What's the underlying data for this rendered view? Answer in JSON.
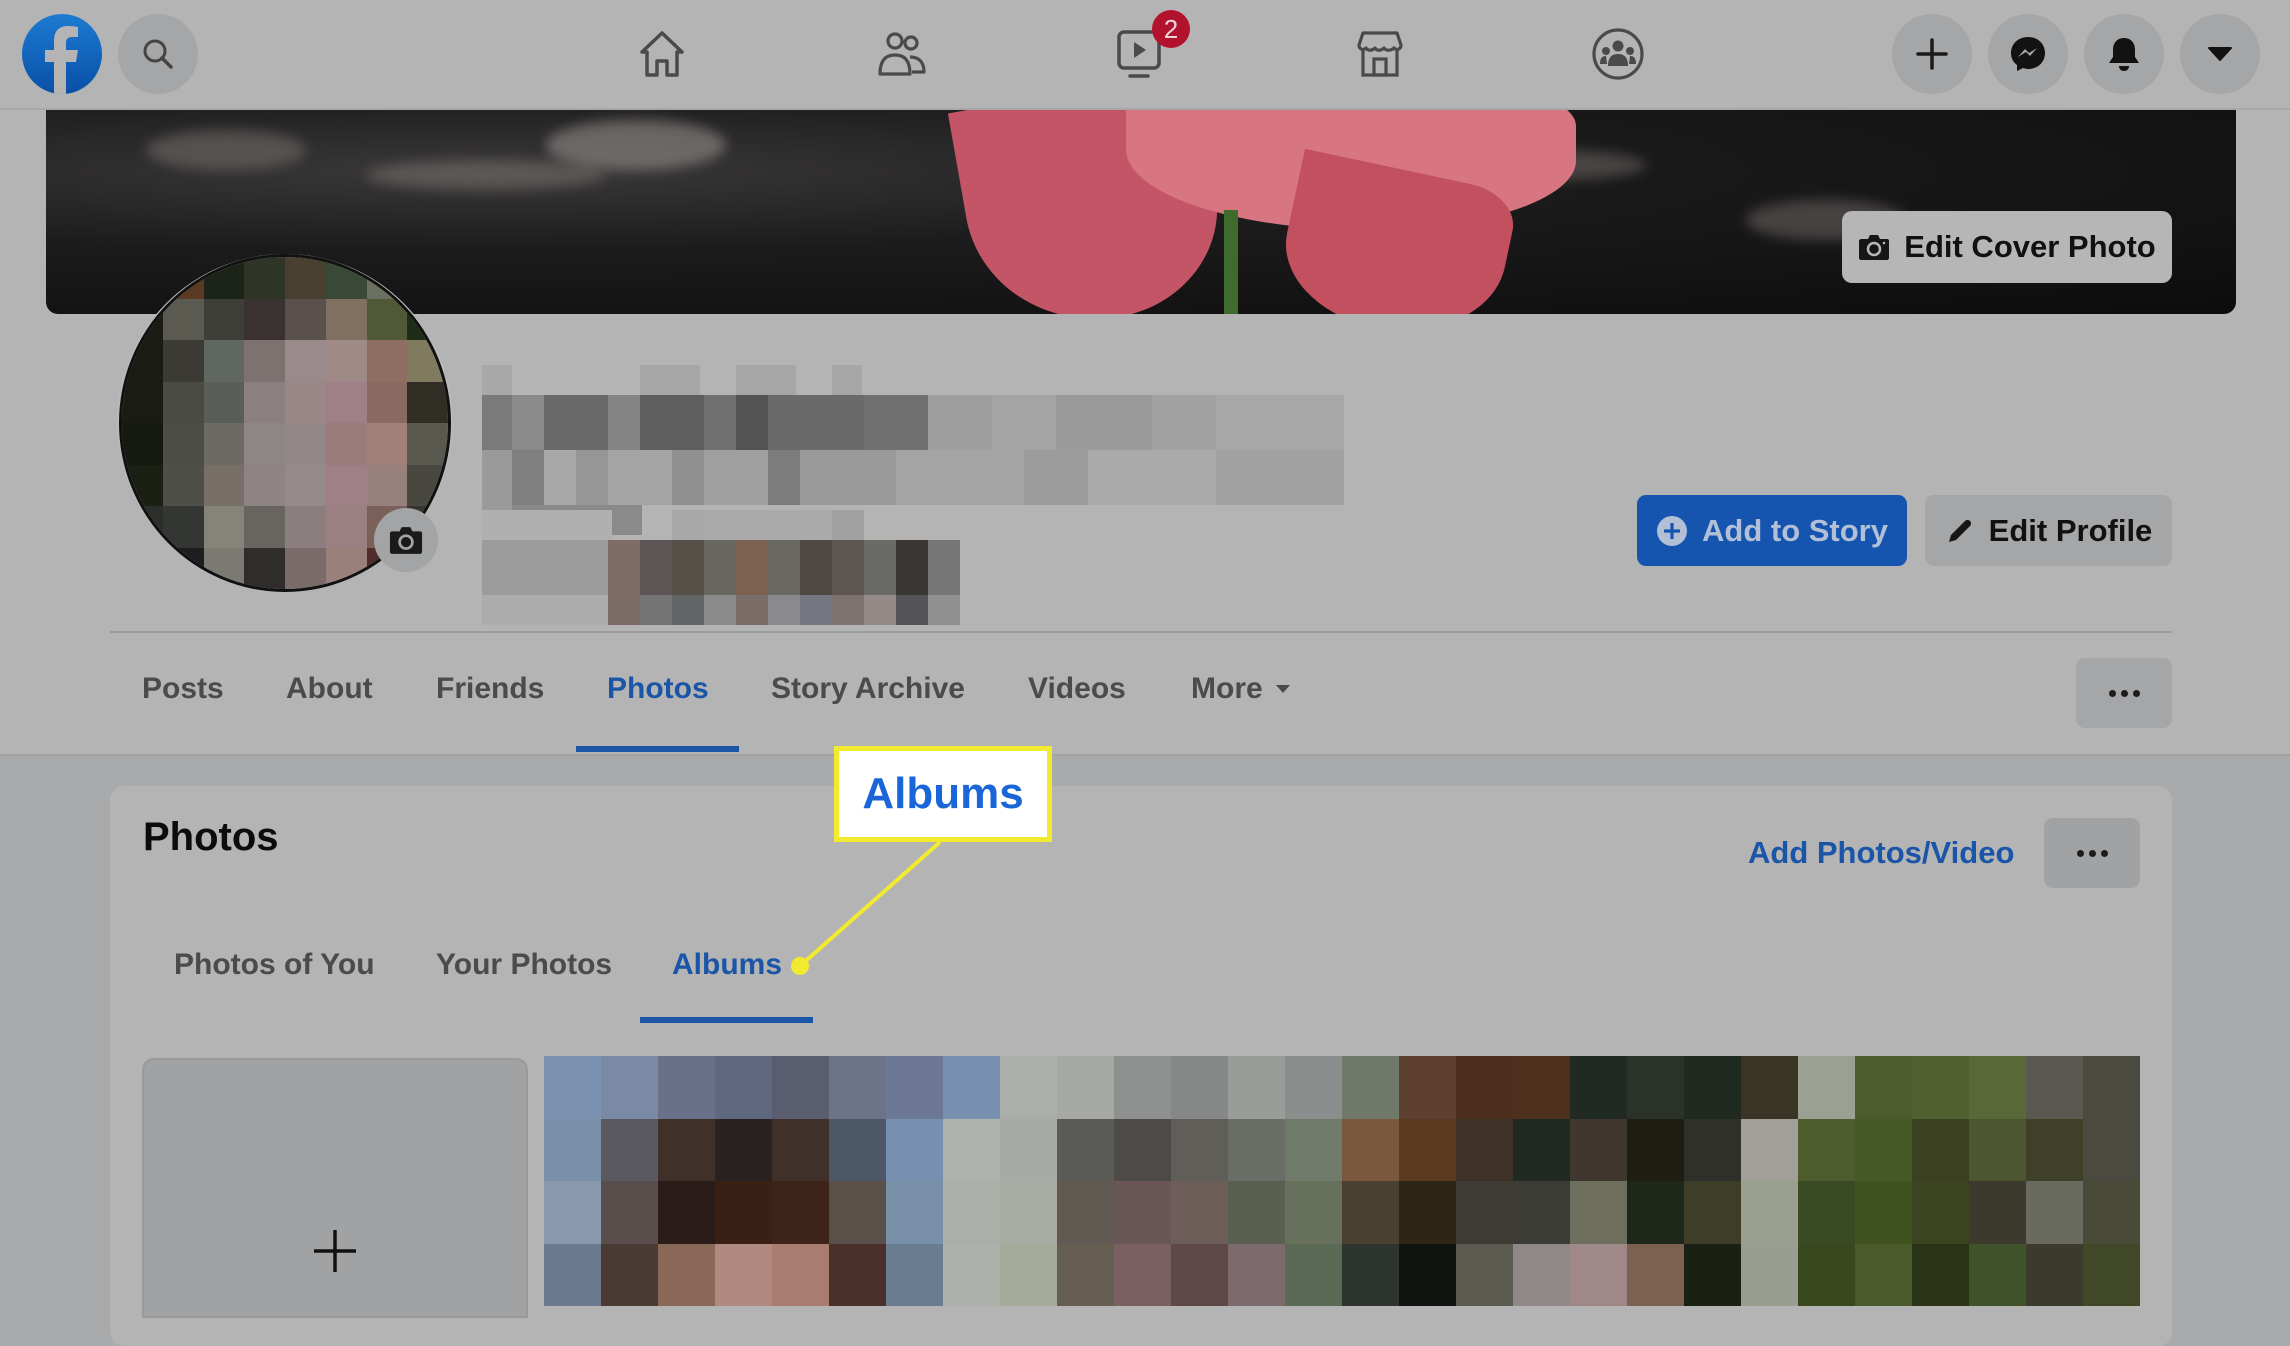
{
  "topnav": {
    "logo": "facebook-logo",
    "search_icon": "search-icon",
    "center_icons": [
      "home-icon",
      "friends-icon",
      "watch-icon",
      "marketplace-icon",
      "groups-icon"
    ],
    "watch_badge": "2",
    "right_icons": [
      "plus-icon",
      "messenger-icon",
      "bell-icon",
      "caret-down-icon"
    ]
  },
  "cover": {
    "edit_cover_label": "Edit Cover Photo"
  },
  "profile": {
    "name_redacted": true,
    "add_to_story_label": "Add to Story",
    "edit_profile_label": "Edit Profile"
  },
  "tabs": {
    "items": [
      "Posts",
      "About",
      "Friends",
      "Photos",
      "Story Archive",
      "Videos",
      "More"
    ],
    "active": "Photos"
  },
  "photos_card": {
    "title": "Photos",
    "add_photos_label": "Add Photos/Video",
    "subtabs": [
      "Photos of You",
      "Your Photos",
      "Albums"
    ],
    "active_subtab": "Albums"
  },
  "callout": {
    "label": "Albums"
  },
  "colors": {
    "brand_blue": "#1a55a8",
    "callout_yellow": "#f2ea2f",
    "badge_red": "#b3122c",
    "overlay_gray": "#b4b4b4"
  }
}
